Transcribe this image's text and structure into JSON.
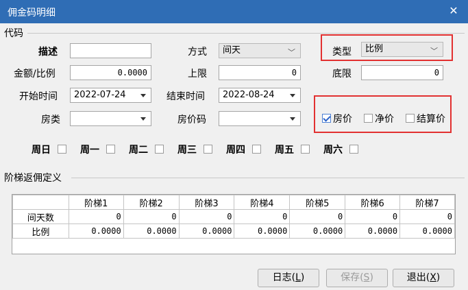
{
  "window": {
    "title": "佣金码明细",
    "close_glyph": "✕"
  },
  "sections": {
    "code": "代码",
    "tier_def": "阶梯返佣定义"
  },
  "fields": {
    "desc_label": "描述",
    "desc_value": "",
    "mode_label": "方式",
    "mode_value": "间天",
    "type_label": "类型",
    "type_value": "比例",
    "amount_label": "金额/比例",
    "amount_value": "0.0000",
    "upper_label": "上限",
    "upper_value": "0",
    "lower_label": "底限",
    "lower_value": "0",
    "start_label": "开始时间",
    "start_value": "2022-07-24",
    "end_label": "结束时间",
    "end_value": "2022-08-24",
    "roomtype_label": "房类",
    "roomtype_value": "",
    "ratecode_label": "房价码",
    "ratecode_value": ""
  },
  "price_checks": [
    {
      "label": "房价",
      "checked": true
    },
    {
      "label": "净价",
      "checked": false
    },
    {
      "label": "结算价",
      "checked": false
    }
  ],
  "weekdays": [
    {
      "label": "周日",
      "checked": false
    },
    {
      "label": "周一",
      "checked": false
    },
    {
      "label": "周二",
      "checked": false
    },
    {
      "label": "周三",
      "checked": false
    },
    {
      "label": "周四",
      "checked": false
    },
    {
      "label": "周五",
      "checked": false
    },
    {
      "label": "周六",
      "checked": false
    }
  ],
  "tier_table": {
    "columns": [
      "",
      "阶梯1",
      "阶梯2",
      "阶梯3",
      "阶梯4",
      "阶梯5",
      "阶梯6",
      "阶梯7"
    ],
    "rows": [
      [
        "间天数",
        "0",
        "0",
        "0",
        "0",
        "0",
        "0",
        "0"
      ],
      [
        "比例",
        "0.0000",
        "0.0000",
        "0.0000",
        "0.0000",
        "0.0000",
        "0.0000",
        "0.0000"
      ]
    ]
  },
  "buttons": {
    "log": {
      "text": "日志(",
      "mnemonic": "L",
      "tail": ")"
    },
    "save": {
      "text": "保存(",
      "mnemonic": "S",
      "tail": ")"
    },
    "exit": {
      "text": "退出(",
      "mnemonic": "X",
      "tail": ")"
    }
  },
  "colors": {
    "titlebar": "#2f6db5",
    "highlight": "#e23030"
  }
}
